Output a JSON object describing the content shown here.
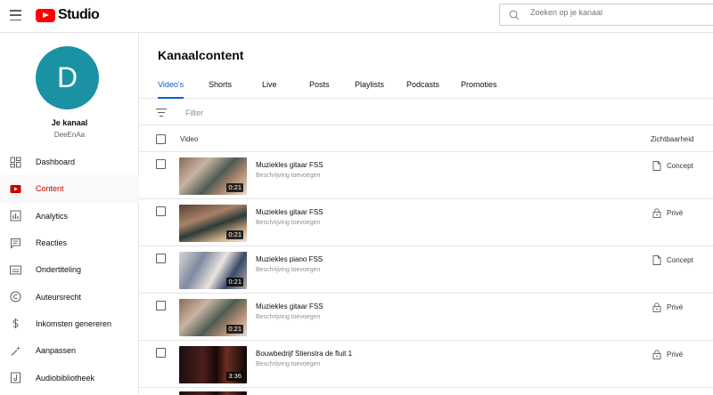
{
  "header": {
    "logo_text": "Studio",
    "search_placeholder": "Zoeken op je kanaal"
  },
  "sidebar": {
    "avatar_letter": "D",
    "avatar_color": "#1a92a4",
    "channel_title": "Je kanaal",
    "channel_handle": "DeeEnAa",
    "items": [
      {
        "label": "Dashboard",
        "icon": "dashboard-icon"
      },
      {
        "label": "Content",
        "icon": "content-icon",
        "active": true
      },
      {
        "label": "Analytics",
        "icon": "analytics-icon"
      },
      {
        "label": "Reacties",
        "icon": "comments-icon"
      },
      {
        "label": "Ondertiteling",
        "icon": "subtitles-icon"
      },
      {
        "label": "Auteursrecht",
        "icon": "copyright-icon"
      },
      {
        "label": "Inkomsten genereren",
        "icon": "dollar-icon"
      },
      {
        "label": "Aanpassen",
        "icon": "customize-icon"
      },
      {
        "label": "Audiobibliotheek",
        "icon": "audio-library-icon"
      }
    ]
  },
  "main": {
    "title": "Kanaalcontent",
    "tabs": [
      {
        "label": "Video's",
        "active": true
      },
      {
        "label": "Shorts"
      },
      {
        "label": "Live"
      },
      {
        "label": "Posts"
      },
      {
        "label": "Playlists"
      },
      {
        "label": "Podcasts"
      },
      {
        "label": "Promoties"
      }
    ],
    "filter_label": "Filter",
    "columns": {
      "video": "Video",
      "visibility": "Zichtbaarheid"
    },
    "rows": [
      {
        "title": "Muziekles gitaar FSS",
        "description": "Beschrijving toevoegen",
        "duration": "0:21",
        "visibility": "Concept",
        "visibility_icon": "draft-file-icon"
      },
      {
        "title": "Muziekles gitaar FSS",
        "description": "Beschrijving toevoegen",
        "duration": "0:21",
        "visibility": "Privé",
        "visibility_icon": "lock-icon"
      },
      {
        "title": "Muziekles piano FSS",
        "description": "Beschrijving toevoegen",
        "duration": "0:21",
        "visibility": "Concept",
        "visibility_icon": "draft-file-icon"
      },
      {
        "title": "Muziekles gitaar FSS",
        "description": "Beschrijving toevoegen",
        "duration": "0:21",
        "visibility": "Privé",
        "visibility_icon": "lock-icon"
      },
      {
        "title": "Bouwbedrijf Stienstra de fluit 1",
        "description": "Beschrijving toevoegen",
        "duration": "3:36",
        "visibility": "Privé",
        "visibility_icon": "lock-icon"
      }
    ]
  },
  "colors": {
    "accent": "#065fd4",
    "active_nav": "#cc0000",
    "brand_red": "#ff0000"
  }
}
